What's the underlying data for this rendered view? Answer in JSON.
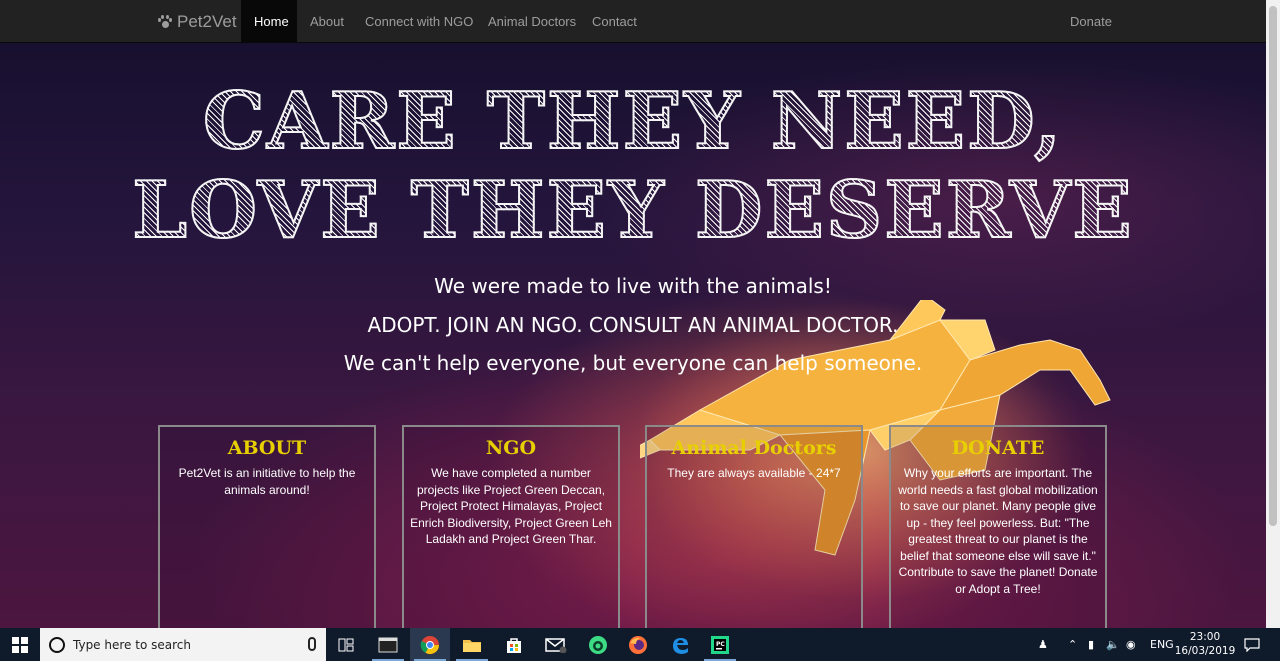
{
  "navbar": {
    "brand": "Pet2Vet",
    "items": [
      {
        "label": "Home",
        "active": true
      },
      {
        "label": "About"
      },
      {
        "label": "Connect with NGO"
      },
      {
        "label": "Animal Doctors"
      },
      {
        "label": "Contact"
      }
    ],
    "donate": "Donate"
  },
  "hero": {
    "line1": "CARE THEY NEED,",
    "line2": "LOVE THEY DESERVE",
    "tagline1": "We were made to live with the animals!",
    "tagline2": "ADOPT. JOIN AN NGO. CONSULT AN ANIMAL DOCTOR.",
    "tagline3": "We can't help everyone, but everyone can help someone."
  },
  "cards": [
    {
      "title": "ABOUT",
      "text": "Pet2Vet is an initiative to help the animals around!"
    },
    {
      "title": "NGO",
      "text": "We have completed a number projects like Project Green Deccan, Project Protect Himalayas, Project Enrich Biodiversity, Project Green Leh Ladakh and Project Green Thar."
    },
    {
      "title": "Animal Doctors",
      "text": "They are always available - 24*7"
    },
    {
      "title": "DONATE",
      "text": "Why your efforts are important. The world needs a fast global mobilization to save our planet. Many people give up - they feel powerless. But: \"The greatest threat to our planet is the belief that someone else will save it.\" Contribute to save the planet! Donate or Adopt a Tree!"
    }
  ],
  "colors": {
    "accent_title": "#e8d000",
    "navbar_bg": "#222222"
  },
  "taskbar": {
    "search_placeholder": "Type here to search",
    "language": "ENG",
    "time": "23:00",
    "date": "16/03/2019"
  }
}
